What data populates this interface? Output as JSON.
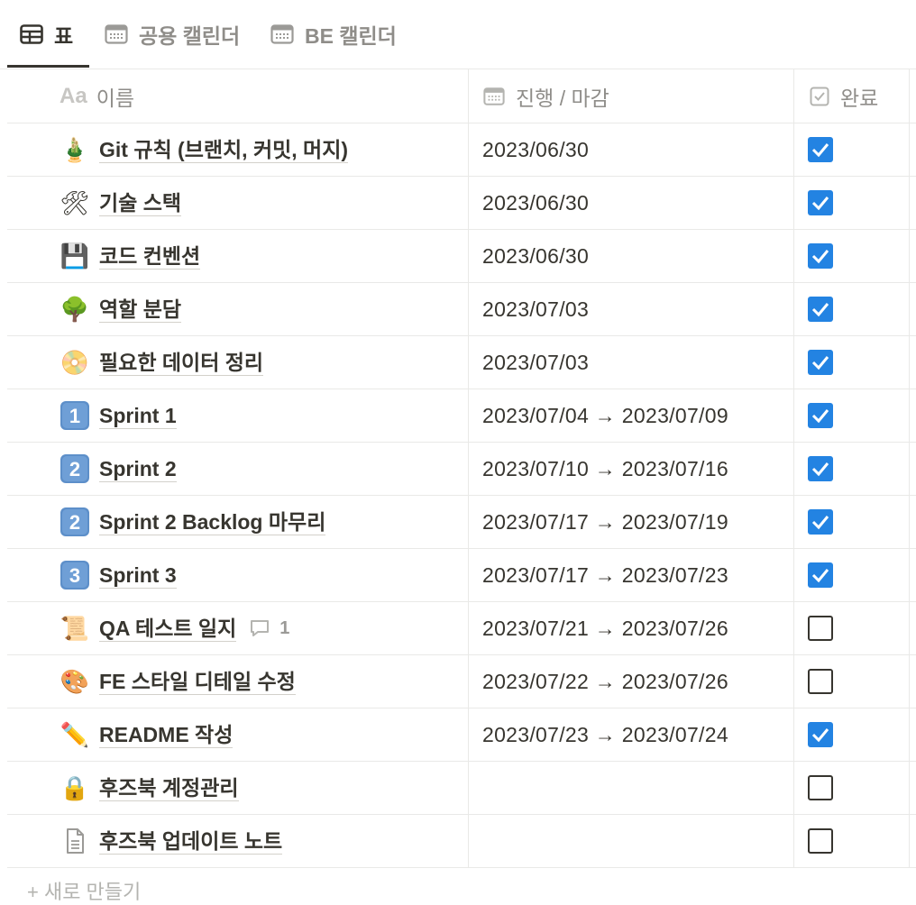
{
  "tabs": [
    {
      "label": "표",
      "icon": "table-icon",
      "active": true
    },
    {
      "label": "공용 캘린더",
      "icon": "calendar-icon",
      "active": false
    },
    {
      "label": "BE 캘린더",
      "icon": "calendar-icon",
      "active": false
    }
  ],
  "columns": {
    "name": {
      "icon_text": "Aa",
      "label": "이름"
    },
    "date": {
      "label": "진행 / 마감"
    },
    "done": {
      "label": "완료"
    }
  },
  "rows": [
    {
      "icon": "bamboo",
      "title": "Git 규칙 (브랜치, 커밋, 머지)",
      "date": "2023/06/30",
      "done": true
    },
    {
      "icon": "hammer-and-wrench",
      "title": "기술 스택",
      "date": "2023/06/30",
      "done": true
    },
    {
      "icon": "floppy-disk",
      "title": "코드 컨벤션",
      "date": "2023/06/30",
      "done": true
    },
    {
      "icon": "tree",
      "title": "역할 분담",
      "date": "2023/07/03",
      "done": true
    },
    {
      "icon": "dvd",
      "title": "필요한 데이터 정리",
      "date": "2023/07/03",
      "done": true
    },
    {
      "icon": "keycap-1",
      "title": "Sprint 1",
      "date": "2023/07/04 → 2023/07/09",
      "done": true
    },
    {
      "icon": "keycap-2",
      "title": "Sprint 2",
      "date": "2023/07/10 → 2023/07/16",
      "done": true
    },
    {
      "icon": "keycap-2",
      "title": "Sprint 2 Backlog 마무리",
      "date": "2023/07/17 → 2023/07/19",
      "done": true
    },
    {
      "icon": "keycap-3",
      "title": "Sprint 3",
      "date": "2023/07/17 → 2023/07/23",
      "done": true
    },
    {
      "icon": "scroll",
      "title": "QA 테스트 일지",
      "date": "2023/07/21 → 2023/07/26",
      "done": false,
      "comments": "1"
    },
    {
      "icon": "artist-palette",
      "title": "FE 스타일 디테일 수정",
      "date": "2023/07/22 → 2023/07/26",
      "done": false
    },
    {
      "icon": "pencil",
      "title": "README 작성",
      "date": "2023/07/23 → 2023/07/24",
      "done": true
    },
    {
      "icon": "lock",
      "title": "후즈북 계정관리",
      "date": "",
      "done": false
    },
    {
      "icon": "page",
      "title": "후즈북 업데이트 노트",
      "date": "",
      "done": false
    }
  ],
  "footer": {
    "new_label": "+ 새로 만들기"
  },
  "colors": {
    "accent": "#2383e2",
    "text": "#37352f",
    "muted": "#8f8d89",
    "border": "#e9e9e7"
  }
}
